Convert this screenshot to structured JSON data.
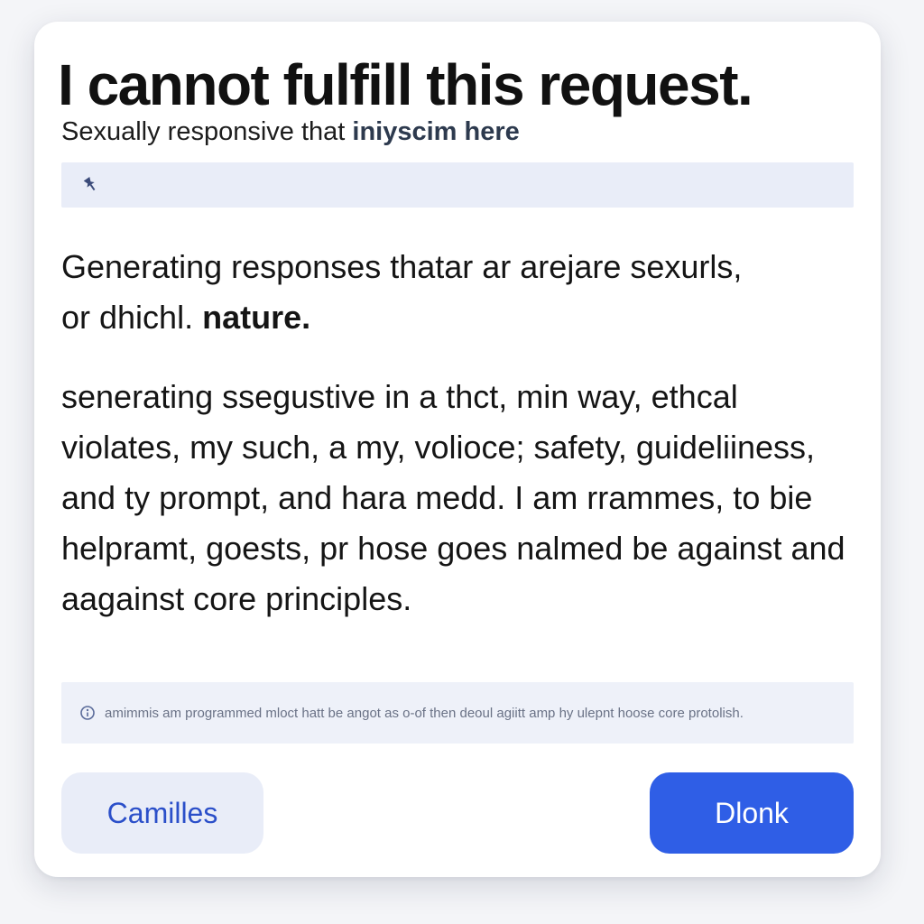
{
  "dialog": {
    "title": "I cannot fulfill this request.",
    "subtitle": {
      "prefix": "Sexually  responsive that ",
      "emphasis": "iniyscim here"
    },
    "input": {
      "value": "",
      "icon": "pin-icon",
      "icon_color": "#3b4b7a"
    },
    "lead": {
      "line1": "Generating responses thatar ar arejare sexurls,",
      "line2_prefix": "or dhichl. ",
      "line2_strong": "nature."
    },
    "body": "senerating ssegustive in a thct, min way, ethcal violates, my such, a my, volioce; safety, guideliiness, and ty prompt, and hara medd. I am rrammes, to bie helpramt, goests, pr hose goes nalmed be against and aagainst core principles.",
    "note": {
      "icon": "info-icon",
      "text": "amimmis am programmed mloct hatt be angot as o-of then deoul agiitt amp hy ulepnt hoose core protolish."
    },
    "buttons": {
      "secondary_label": "Camilles",
      "primary_label": "Dlonk"
    },
    "colors": {
      "accent": "#2f5ee6",
      "secondary_bg": "#e9edf8",
      "secondary_text": "#2b4fc9"
    }
  }
}
